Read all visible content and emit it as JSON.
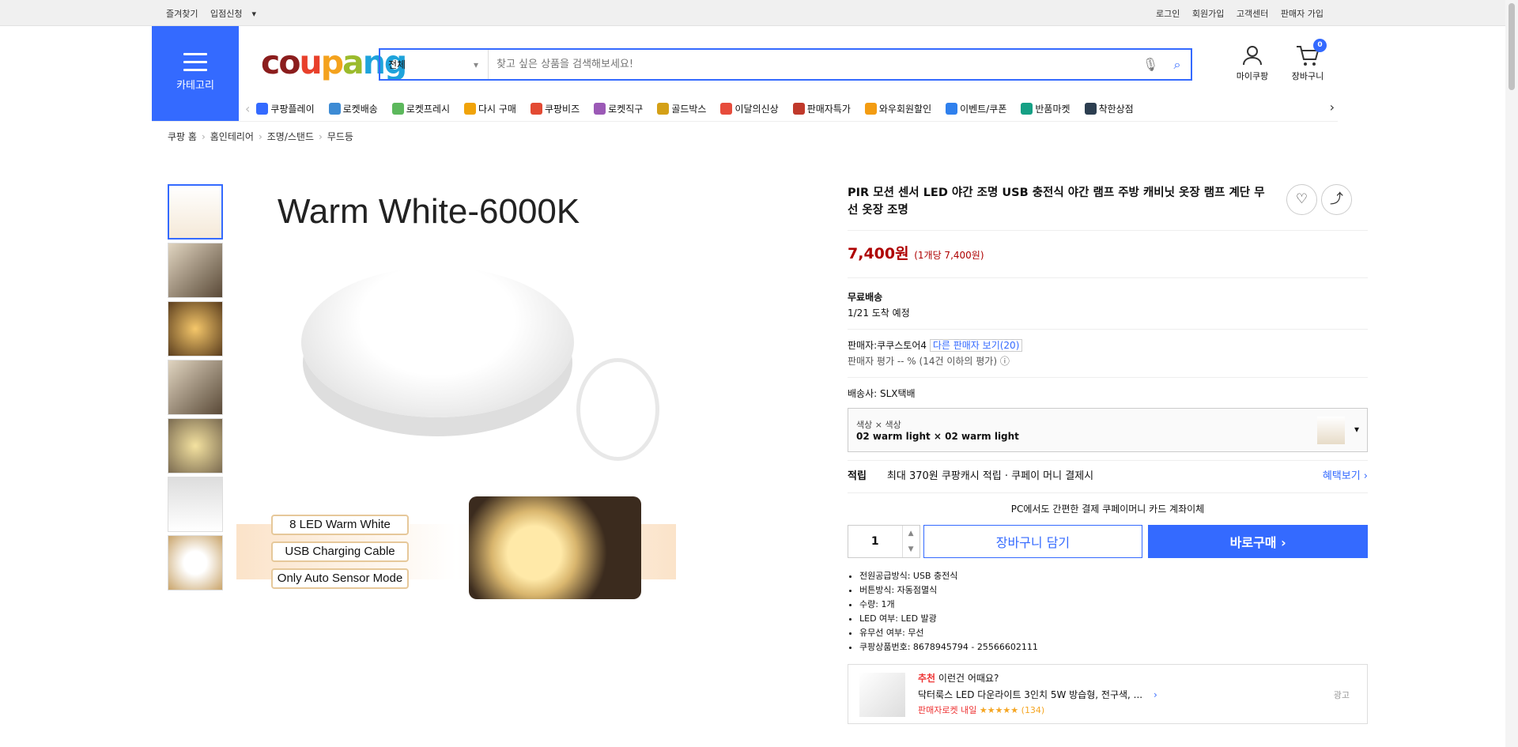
{
  "topbar": {
    "bookmark": "즐겨찾기",
    "apply": "입점신청",
    "login": "로그인",
    "join": "회원가입",
    "cs": "고객센터",
    "seller_join": "판매자 가입"
  },
  "header": {
    "category_label": "카테고리",
    "search_scope": "전체",
    "search_placeholder": "찾고 싶은 상품을 검색해보세요!",
    "mypage": "마이쿠팡",
    "cart": "장바구니",
    "cart_count": "0"
  },
  "nav": [
    "쿠팡플레이",
    "로켓배송",
    "로켓프레시",
    "다시 구매",
    "쿠팡비즈",
    "로켓직구",
    "골드박스",
    "이달의신상",
    "판매자특가",
    "와우회원할인",
    "이벤트/쿠폰",
    "반품마켓",
    "착한상점"
  ],
  "breadcrumb": [
    "쿠팡 홈",
    "홈인테리어",
    "조명/스탠드",
    "무드등"
  ],
  "image": {
    "title": "Warm White-6000K",
    "pills": [
      "8 LED Warm White",
      "USB Charging Cable",
      "Only Auto Sensor Mode"
    ]
  },
  "product": {
    "title": "PIR 모션 센서 LED 야간 조명 USB 충전식 야간 램프 주방 캐비닛 옷장 램프 계단 무선 옷장 조명",
    "price": "7,400원",
    "unit_price": "(1개당 7,400원)",
    "free_ship": "무료배송",
    "arrival": "1/21 도착 예정",
    "seller": "판매자:쿠쿠스토어4",
    "other_sellers": "다른 판매자 보기(20)",
    "seller_rating": "판매자 평가  -- % (14건 이하의 평가)",
    "courier": "배송사:  SLX택배",
    "option_label": "색상 × 색상",
    "option_value": "02 warm light × 02 warm light",
    "reward_label": "적립",
    "reward_text": "최대 370원 쿠팡캐시 적립 · 쿠페이 머니 결제시",
    "benefit": "혜택보기 ›",
    "pay_line": "PC에서도 간편한 결제  쿠페이머니  카드  계좌이체",
    "qty": "1",
    "cart_btn": "장바구니 담기",
    "buy_btn": "바로구매 ›",
    "specs": [
      "전원공급방식: USB 충전식",
      "버튼방식: 자동점멸식",
      "수량: 1개",
      "LED 여부: LED 발광",
      "유무선 여부: 무선",
      "쿠팡상품번호: 8678945794 - 25566602111"
    ]
  },
  "rec": {
    "tag": "추천",
    "title": "이런건 어때요?",
    "item": "닥터룩스 LED 다운라이트 3인치 5W 방습형, 전구색, ...",
    "badge": "판매자로켓 내일",
    "rating": "★★★★★ (134)",
    "ad": "광고"
  }
}
